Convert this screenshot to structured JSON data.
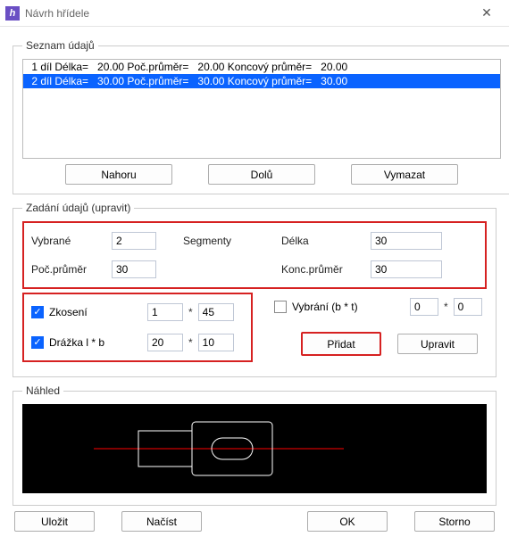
{
  "title": "Návrh hřídele",
  "list": {
    "legend": "Seznam údajů",
    "rows": [
      " 1 díl Délka=   20.00 Poč.průměr=   20.00 Koncový průměr=   20.00",
      " 2 díl Délka=   30.00 Poč.průměr=   30.00 Koncový průměr=   30.00"
    ],
    "selected_index": 1,
    "btn_up": "Nahoru",
    "btn_down": "Dolů",
    "btn_del": "Vymazat"
  },
  "edit": {
    "legend": "Zadání údajů (upravit)",
    "lbl_selected": "Vybrané",
    "val_selected": "2",
    "lbl_segments": "Segmenty",
    "lbl_length": "Délka",
    "val_length": "30",
    "lbl_startdia": "Poč.průměr",
    "val_startdia": "30",
    "lbl_enddia": "Konc.průměr",
    "val_enddia": "30",
    "chamfer_checked": true,
    "lbl_chamfer": "Zkosení",
    "val_chamfer_a": "1",
    "mult": "*",
    "val_chamfer_b": "45",
    "groove_checked": true,
    "lbl_groove": "Drážka l * b",
    "val_groove_a": "20",
    "val_groove_b": "10",
    "lbl_cut": "Vybrání (b * t)",
    "cut_checked": false,
    "val_cut_a": "0",
    "val_cut_b": "0",
    "btn_add": "Přidat",
    "btn_edit": "Upravit"
  },
  "preview_legend": "Náhled",
  "buttons": {
    "save": "Uložit",
    "load": "Načíst",
    "ok": "OK",
    "cancel": "Storno"
  }
}
